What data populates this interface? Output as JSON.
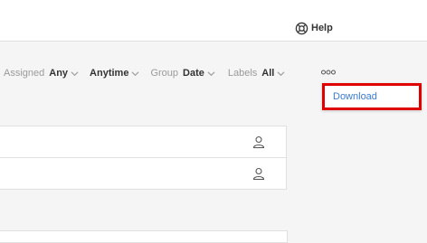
{
  "header": {
    "help_label": "Help",
    "help_icon": "lifebuoy-icon"
  },
  "filters": {
    "assigned": {
      "label": "Assigned",
      "value": "Any"
    },
    "time": {
      "value": "Anytime"
    },
    "group": {
      "label": "Group",
      "value": "Date"
    },
    "labels": {
      "label": "Labels",
      "value": "All"
    }
  },
  "more_menu": {
    "icon": "more-dots-icon",
    "items": [
      {
        "label": "Download"
      }
    ]
  },
  "list": {
    "rows": [
      {
        "icon": "user-icon"
      },
      {
        "icon": "user-icon"
      }
    ]
  },
  "colors": {
    "accent": "#3a7bd5",
    "highlight": "#e00000",
    "background": "#f5f5f5"
  }
}
